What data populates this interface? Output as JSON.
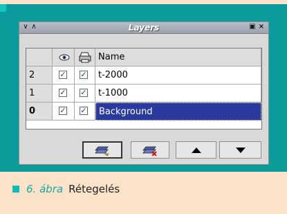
{
  "window": {
    "title": "Layers",
    "titlebar_left": "∨ ∧",
    "titlebar_right": "▣×"
  },
  "grid": {
    "header": {
      "name_label": "Name"
    },
    "rows": [
      {
        "num": "2",
        "visible": true,
        "printable": true,
        "name": "t-2000",
        "selected": false
      },
      {
        "num": "1",
        "visible": true,
        "printable": true,
        "name": "t-1000",
        "selected": false
      },
      {
        "num": "0",
        "visible": true,
        "printable": true,
        "name": "Background",
        "selected": true
      }
    ]
  },
  "buttons": [
    {
      "name": "new-layer-button",
      "icon": "new-layer-icon"
    },
    {
      "name": "delete-layer-button",
      "icon": "delete-layer-icon"
    },
    {
      "name": "move-up-button",
      "icon": "arrow-up-icon"
    },
    {
      "name": "move-down-button",
      "icon": "arrow-down-icon"
    }
  ],
  "caption": {
    "figure": "6. ábra",
    "text": "Rétegelés"
  },
  "colors": {
    "panel": "#0b9b9a",
    "selection": "#2b3a9e",
    "page_bg": "#fbe3c9"
  }
}
